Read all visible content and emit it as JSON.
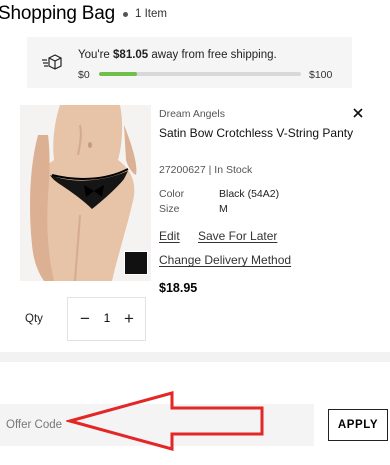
{
  "header": {
    "title": "Shopping Bag",
    "count": "1 Item"
  },
  "shipping": {
    "prefix": "You're ",
    "amount": "$81.05",
    "suffix": " away from free shipping.",
    "min_label": "$0",
    "max_label": "$100",
    "progress_fraction": 0.19,
    "progress_color": "#6ec04a",
    "icon": "shipping-box-icon"
  },
  "item": {
    "brand": "Dream Angels",
    "name": "Satin Bow Crotchless V-String Panty",
    "sku_status": "27200627 | In Stock",
    "color_label": "Color",
    "color_value": "Black (54A2)",
    "size_label": "Size",
    "size_value": "M",
    "edit_label": "Edit",
    "save_label": "Save For Later",
    "delivery_label": "Change Delivery Method",
    "price": "$18.95",
    "remove_icon": "close-icon",
    "swatch_color": "#111111"
  },
  "quantity": {
    "label": "Qty",
    "value": "1",
    "minus": "−",
    "plus": "+"
  },
  "offer": {
    "placeholder": "Offer Code",
    "apply_label": "APPLY"
  },
  "annotation": {
    "arrow_color": "#e32626"
  }
}
